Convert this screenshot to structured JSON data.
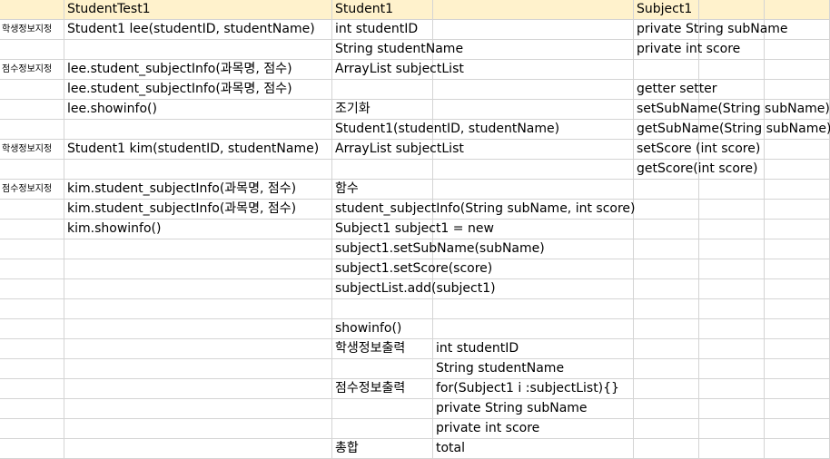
{
  "header": {
    "col_a": "",
    "col_b": "StudentTest1",
    "col_c": "Student1",
    "col_d": "",
    "col_e": "Subject1",
    "col_f": "",
    "col_g": ""
  },
  "rows": [
    {
      "a": "학생정보지정",
      "b": "Student1 lee(studentID, studentName)",
      "c": "int studentID",
      "d": "",
      "e": "private String subName"
    },
    {
      "a": "",
      "b": "",
      "c": "String studentName",
      "d": "",
      "e": "private int score"
    },
    {
      "a": "점수정보지정",
      "b": "lee.student_subjectInfo(과목명, 점수)",
      "c": "ArrayList subjectList",
      "d": "",
      "e": ""
    },
    {
      "a": "",
      "b": "lee.student_subjectInfo(과목명, 점수)",
      "c": "",
      "d": "",
      "e": "getter setter"
    },
    {
      "a": "",
      "b": "lee.showinfo()",
      "c": "조기화",
      "d": "",
      "e": "setSubName(String subName)"
    },
    {
      "a": "",
      "b": "",
      "c": "Student1(studentID, studentName)",
      "d": "",
      "e": "getSubName(String subName)"
    },
    {
      "a": "학생정보지정",
      "b": "Student1 kim(studentID, studentName)",
      "c": "ArrayList subjectList",
      "d": "",
      "e": "setScore (int score)"
    },
    {
      "a": "",
      "b": "",
      "c": "",
      "d": "",
      "e": "getScore(int score)"
    },
    {
      "a": "점수정보지정",
      "b": "kim.student_subjectInfo(과목명, 점수)",
      "c": "함수",
      "d": "",
      "e": ""
    },
    {
      "a": "",
      "b": "kim.student_subjectInfo(과목명, 점수)",
      "c": "student_subjectInfo(String subName, int score)",
      "d": "",
      "e": ""
    },
    {
      "a": "",
      "b": "kim.showinfo()",
      "c": "Subject1 subject1 = new",
      "d": "",
      "e": ""
    },
    {
      "a": "",
      "b": "",
      "c": "subject1.setSubName(subName)",
      "d": "",
      "e": ""
    },
    {
      "a": "",
      "b": "",
      "c": "subject1.setScore(score)",
      "d": "",
      "e": ""
    },
    {
      "a": "",
      "b": "",
      "c": "subjectList.add(subject1)",
      "d": "",
      "e": ""
    },
    {
      "a": "",
      "b": "",
      "c": "",
      "d": "",
      "e": ""
    },
    {
      "a": "",
      "b": "",
      "c": "showinfo()",
      "d": "",
      "e": ""
    },
    {
      "a": "",
      "b": "",
      "c": "학생정보출력",
      "d": "int studentID",
      "e": ""
    },
    {
      "a": "",
      "b": "",
      "c": "",
      "d": "String studentName",
      "e": ""
    },
    {
      "a": "",
      "b": "",
      "c": "점수정보출력",
      "d": "for(Subject1 i :subjectList){}",
      "e": ""
    },
    {
      "a": "",
      "b": "",
      "c": "",
      "d": "private String subName",
      "e": ""
    },
    {
      "a": "",
      "b": "",
      "c": "",
      "d": "private int score",
      "e": ""
    },
    {
      "a": "",
      "b": "",
      "c": "총합",
      "d": "total",
      "e": ""
    }
  ]
}
